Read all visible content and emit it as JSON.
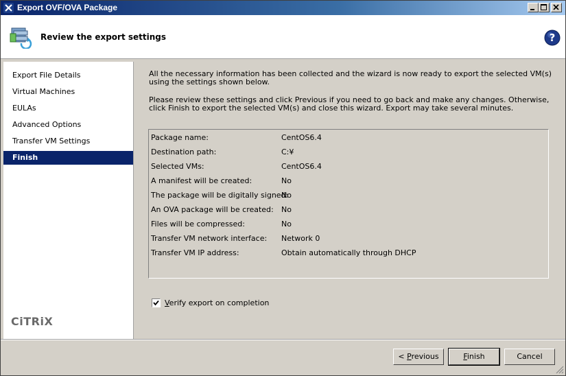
{
  "window": {
    "title": "Export OVF/OVA Package"
  },
  "header": {
    "heading": "Review the export settings"
  },
  "sidebar": {
    "steps": [
      {
        "label": "Export File Details"
      },
      {
        "label": "Virtual Machines"
      },
      {
        "label": "EULAs"
      },
      {
        "label": "Advanced Options"
      },
      {
        "label": "Transfer VM Settings"
      },
      {
        "label": "Finish",
        "active": true
      }
    ]
  },
  "content": {
    "intro": "All the necessary information has been collected and the wizard is now ready to export the selected VM(s) using the settings shown below.",
    "instructions": "Please review these settings and click Previous if you need to go back and make any changes. Otherwise, click Finish to export the selected VM(s) and close this wizard. Export may take several minutes."
  },
  "summary": [
    {
      "key": "Package name:",
      "value": "CentOS6.4"
    },
    {
      "key": "Destination path:",
      "value": "C:¥"
    },
    {
      "key": "Selected VMs:",
      "value": "CentOS6.4"
    },
    {
      "key": "A manifest will be created:",
      "value": "No"
    },
    {
      "key": "The package will be digitally signed:",
      "value": "No"
    },
    {
      "key": "An OVA package will be created:",
      "value": "No"
    },
    {
      "key": "Files will be compressed:",
      "value": "No"
    },
    {
      "key": "Transfer VM network interface:",
      "value": "Network 0"
    },
    {
      "key": "Transfer VM IP address:",
      "value": "Obtain automatically through DHCP"
    }
  ],
  "verify": {
    "label_first": "V",
    "label_rest": "erify export on completion",
    "checked": true
  },
  "buttons": {
    "previous_prefix": "< ",
    "previous_mnemonic": "P",
    "previous_rest": "revious",
    "finish_mnemonic": "F",
    "finish_rest": "inish",
    "cancel": "Cancel"
  },
  "brand": {
    "logo_text": "CiTRiX"
  },
  "colors": {
    "selection": "#0a246a",
    "dialog": "#d4d0c8"
  }
}
